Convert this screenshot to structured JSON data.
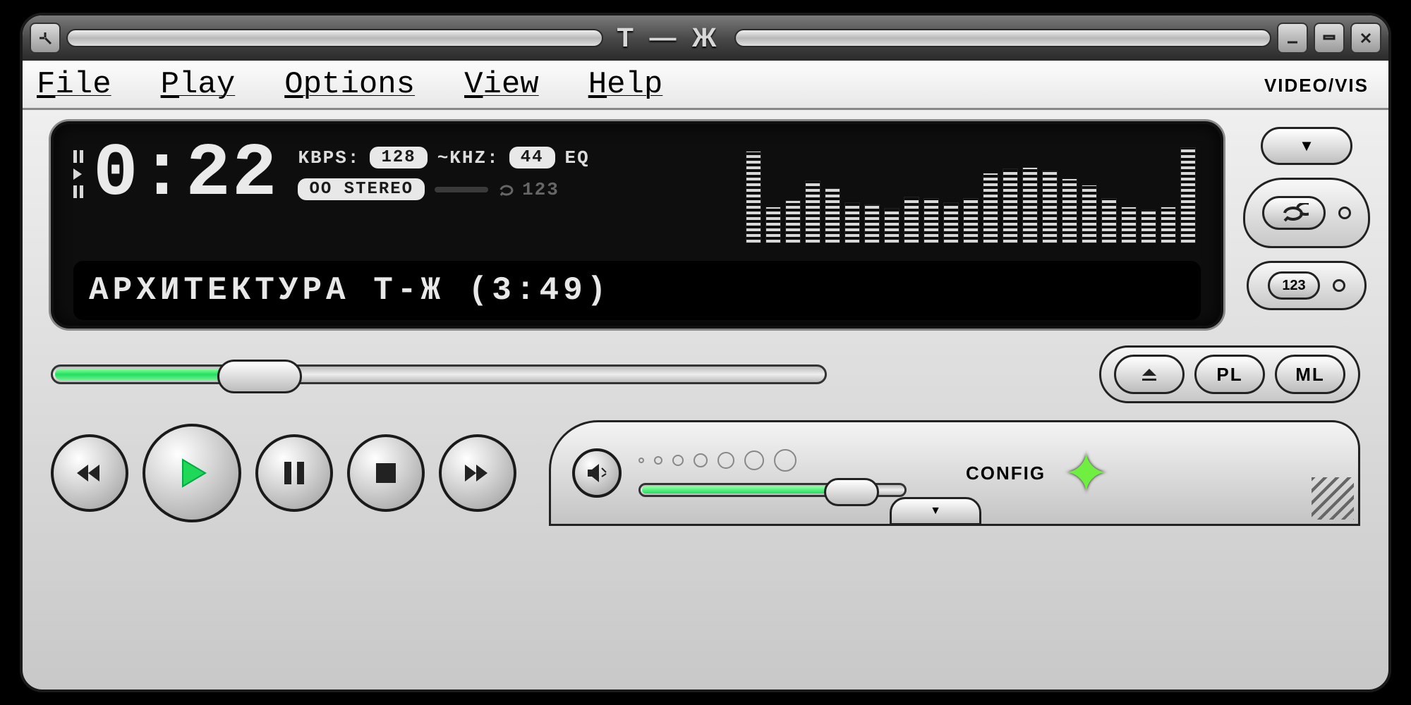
{
  "titlebar": {
    "logo": "T — Ж"
  },
  "menu": {
    "file": "File",
    "play": "Play",
    "options": "Options",
    "view": "View",
    "help": "Help"
  },
  "labels": {
    "videovis": "VIDEO/VIS",
    "config": "CONFIG",
    "kbps": "KBPS:",
    "khz": "~KHZ:",
    "eq": "EQ",
    "stereo": "OO STEREO",
    "seq": "123"
  },
  "display": {
    "time": "0:22",
    "kbps": "128",
    "khz": "44",
    "track": "АРХИТЕКТУРА Т-Ж (3:49)"
  },
  "buttons": {
    "pl": "PL",
    "ml": "ML",
    "seq": "123"
  },
  "progress": {
    "seek_percent": 24,
    "volume_percent": 80
  },
  "eq_bars": [
    92,
    36,
    42,
    62,
    54,
    40,
    38,
    34,
    46,
    44,
    40,
    44,
    70,
    74,
    76,
    72,
    64,
    58,
    44,
    36,
    32,
    36,
    96
  ],
  "colors": {
    "accent": "#35e070"
  }
}
